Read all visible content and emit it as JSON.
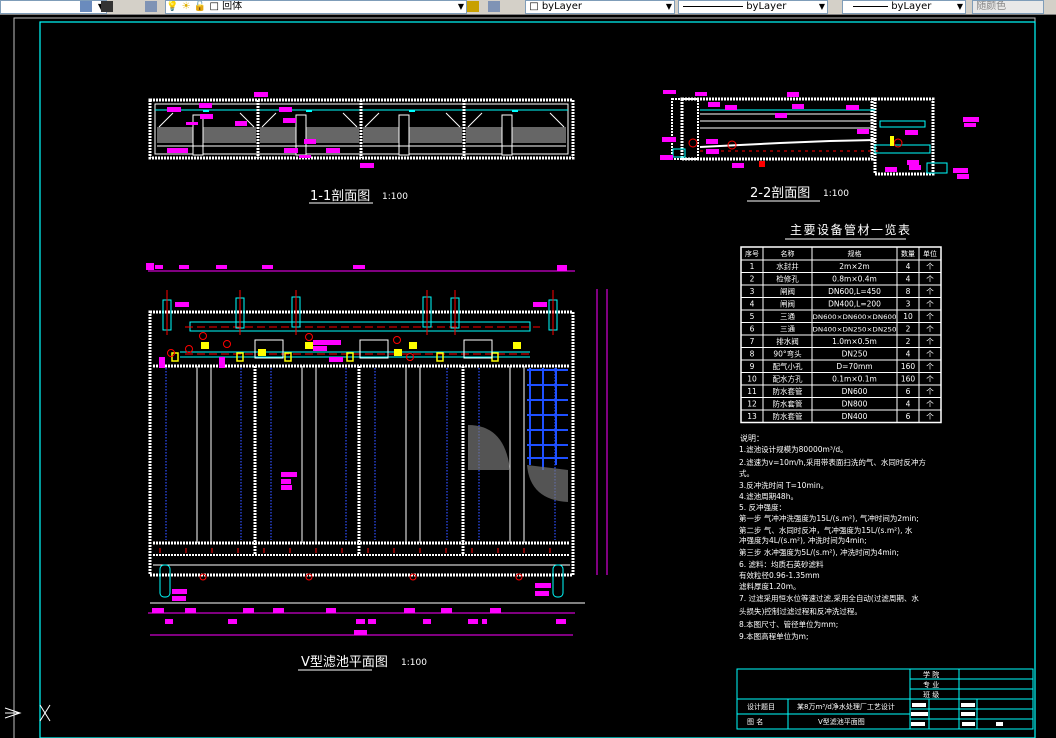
{
  "toolbar": {
    "layer_name": "回体",
    "color": "byLayer",
    "linetype": "byLayer",
    "lineweight": "byLayer",
    "plotstyle": "随颜色"
  },
  "drawing": {
    "section_1_title": "1-1剖面图",
    "section_1_scale": "1:100",
    "section_2_title": "2-2剖面图",
    "section_2_scale": "1:100",
    "plan_title": "V型滤池平面图",
    "plan_scale": "1:100"
  },
  "equipment_table": {
    "title": "主要设备管材一览表",
    "headers": [
      "序号",
      "名称",
      "规格",
      "数量",
      "单位"
    ],
    "rows": [
      [
        "1",
        "水封井",
        "2m×2m",
        "4",
        "个"
      ],
      [
        "2",
        "检修孔",
        "0.8m×0.4m",
        "4",
        "个"
      ],
      [
        "3",
        "闸阀",
        "DN600,L=450",
        "8",
        "个"
      ],
      [
        "4",
        "闸阀",
        "DN400,L=200",
        "3",
        "个"
      ],
      [
        "5",
        "三通",
        "DN600×DN600×DN600",
        "10",
        "个"
      ],
      [
        "6",
        "三通",
        "DN400×DN250×DN250",
        "2",
        "个"
      ],
      [
        "7",
        "排水阀",
        "1.0m×0.5m",
        "2",
        "个"
      ],
      [
        "8",
        "90°弯头",
        "DN250",
        "4",
        "个"
      ],
      [
        "9",
        "配气小孔",
        "D=70mm",
        "160",
        "个"
      ],
      [
        "10",
        "配水方孔",
        "0.1m×0.1m",
        "160",
        "个"
      ],
      [
        "11",
        "防水套管",
        "DN600",
        "6",
        "个"
      ],
      [
        "12",
        "防水套管",
        "DN800",
        "4",
        "个"
      ],
      [
        "13",
        "防水套管",
        "DN400",
        "6",
        "个"
      ]
    ]
  },
  "notes": {
    "heading": "说明：",
    "lines": [
      "1.滤池设计规模为80000m³/d。",
      "2.滤速为v=10m/h,采用带表面扫洗的气、水同时反冲方",
      "式。",
      "3.反冲洗时间 T=10min。",
      "4.滤池周期48h。",
      "5. 反冲强度：",
      "    第一步  气冲冲洗强度为15L/(s.m²), 气冲时间为2min;",
      "    第二步  气、水同时反冲，气冲强度为15L/(s.m²), 水",
      "冲强度为4L/(s.m²), 冲洗时间为4min;",
      "    第三步 水冲强度为5L/(s.m²), 冲洗时间为4min;",
      "6.  滤料：均质石英砂滤料",
      "          有效粒径0.96-1.35mm",
      "          滤料厚度1.20m。",
      "7.  过滤采用恒水位等速过滤,采用全自动(过滤周期、水",
      "头损失)控制过滤过程和反冲洗过程。",
      "8.本图尺寸、管径单位为mm;",
      " 9.本图高程单位为m;"
    ]
  },
  "title_block": {
    "school_label": "学  院",
    "major_label": "专  业",
    "class_label": "班  级",
    "design_topic_label": "设计题目",
    "design_topic": "某8万m³/d净水处理厂工艺设计",
    "drawing_name_label": "图  名",
    "drawing_name": "V型滤池平面图"
  },
  "colors": {
    "background": "#000000",
    "frame": "#00ffff",
    "annotation": "#ff00ff",
    "centerline": "#ff0000",
    "valve": "#ffff00",
    "pipe": "#00ffff",
    "nozzle": "#0000ff"
  }
}
